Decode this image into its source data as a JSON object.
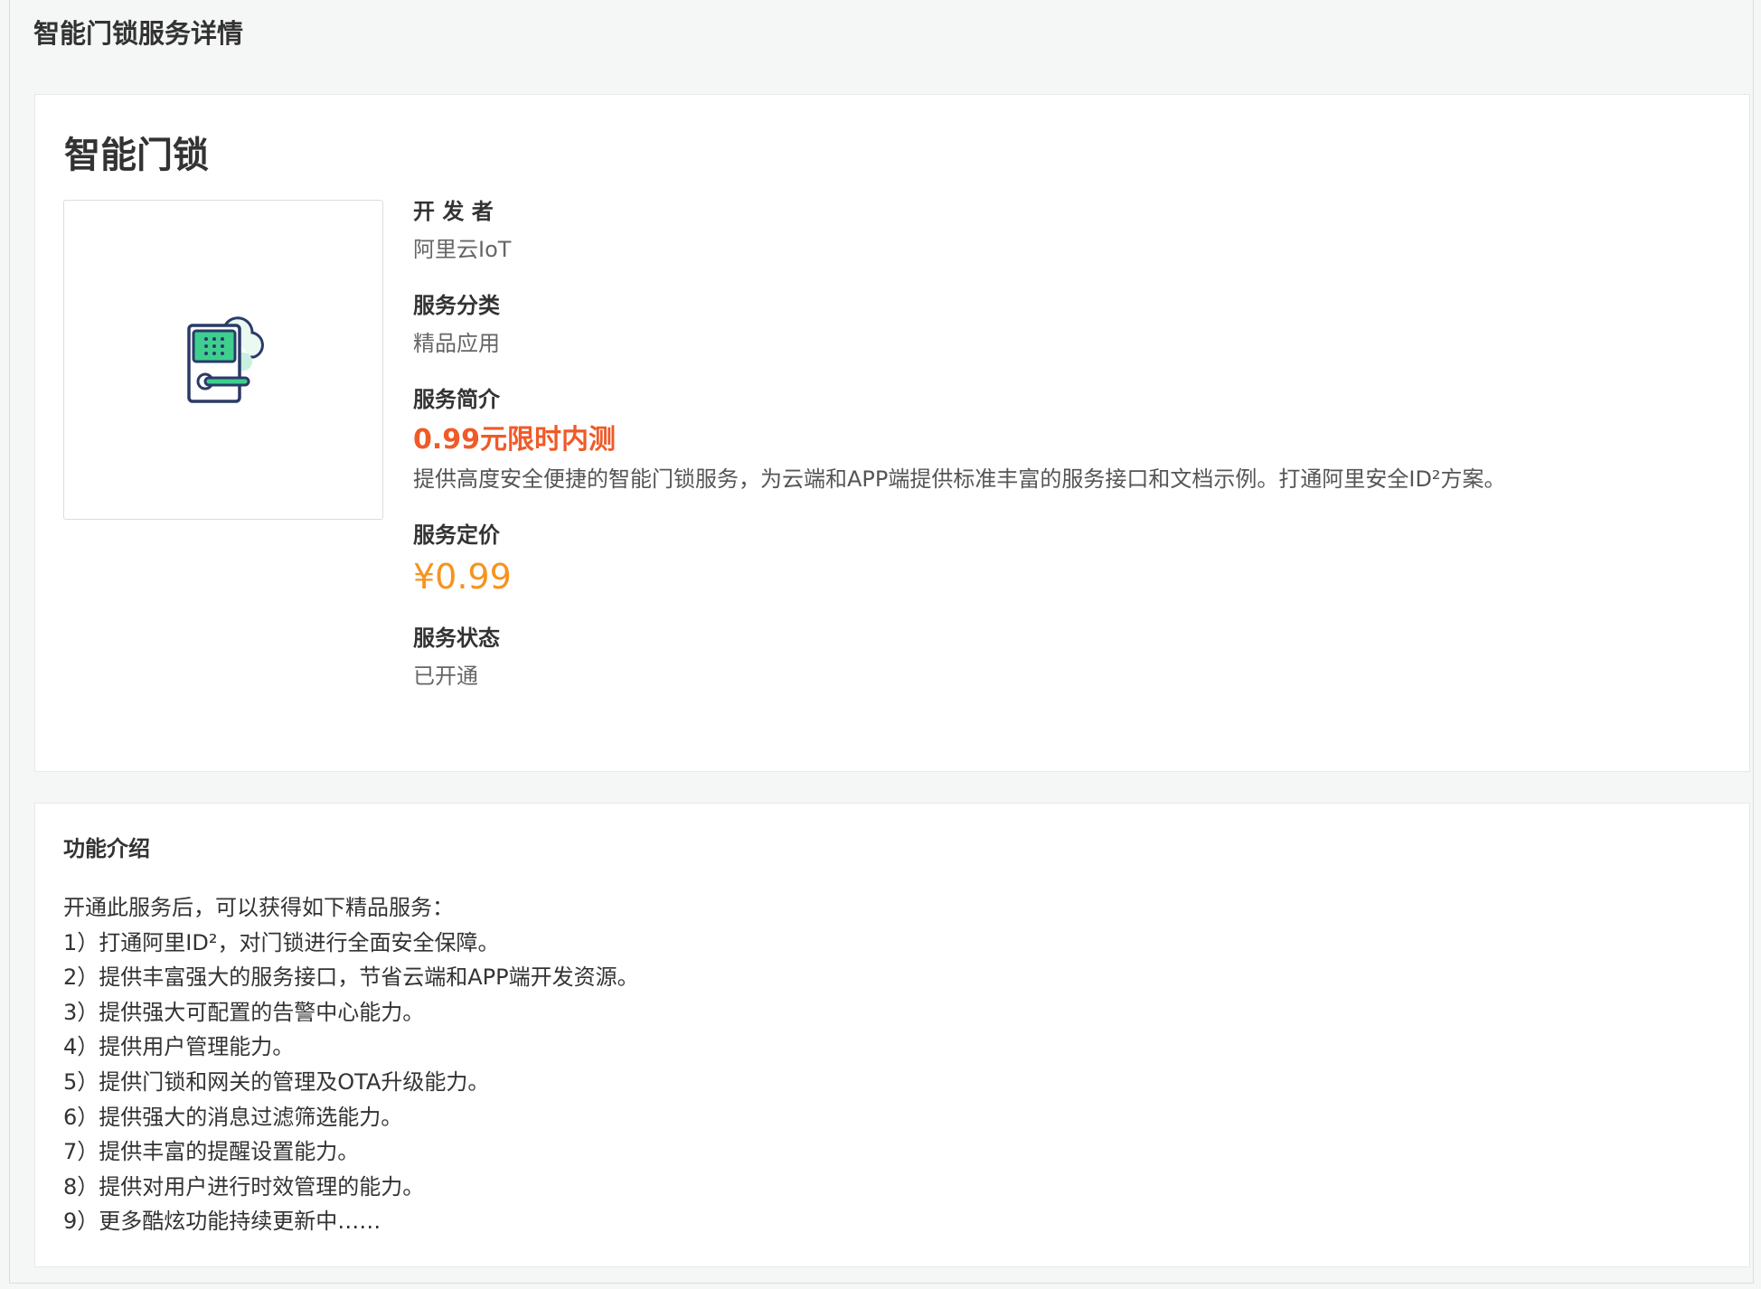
{
  "page": {
    "title": "智能门锁服务详情"
  },
  "service": {
    "name": "智能门锁",
    "logo_icon": "smart-lock-icon",
    "developer_label": "开 发 者",
    "developer_value": "阿里云IoT",
    "category_label": "服务分类",
    "category_value": "精品应用",
    "intro_label": "服务简介",
    "intro_promo": "0.99元限时内测",
    "intro_text": "提供高度安全便捷的智能门锁服务，为云端和APP端提供标准丰富的服务接口和文档示例。打通阿里安全ID²方案。",
    "price_label": "服务定价",
    "price_value": "¥0.99",
    "status_label": "服务状态",
    "status_value": "已开通"
  },
  "features": {
    "title": "功能介绍",
    "lines": [
      "开通此服务后，可以获得如下精品服务：",
      "1）打通阿里ID²，对门锁进行全面安全保障。",
      "2）提供丰富强大的服务接口，节省云端和APP端开发资源。",
      "3）提供强大可配置的告警中心能力。",
      "4）提供用户管理能力。",
      "5）提供门锁和网关的管理及OTA升级能力。",
      "6）提供强大的消息过滤筛选能力。",
      "7）提供丰富的提醒设置能力。",
      "8）提供对用户进行时效管理的能力。",
      "9）更多酷炫功能持续更新中……"
    ]
  },
  "colors": {
    "promo": "#f05a28",
    "price": "#f7931e",
    "icon_green": "#3ecf8e",
    "icon_navy": "#2b3a67"
  }
}
